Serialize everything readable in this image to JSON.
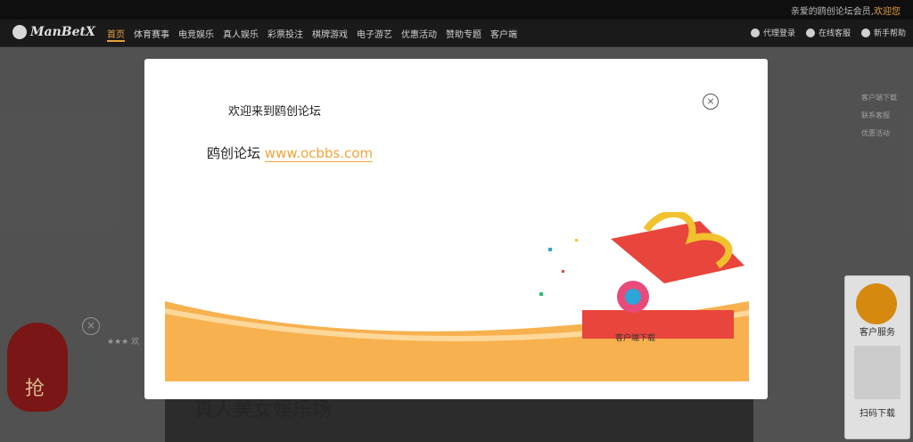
{
  "topbar": {
    "welcome_text": "亲爱的鸥创论坛会员,",
    "welcome_highlight": "欢迎您"
  },
  "logo": {
    "text": "ManBetX"
  },
  "nav": {
    "items": [
      "首页",
      "体育赛事",
      "电竞娱乐",
      "真人娱乐",
      "彩票投注",
      "棋牌游戏",
      "电子游艺",
      "优惠活动",
      "赞助专题",
      "客户端"
    ],
    "active_index": 0
  },
  "nav_right": {
    "items": [
      "代理登录",
      "在线客服",
      "新手帮助"
    ]
  },
  "page": {
    "side_links": [
      "客户端下载",
      "联系客服",
      "优惠活动"
    ],
    "stage_title": "真人美女娱乐场",
    "ticker": "★★★ 欢"
  },
  "bag": {
    "label": "抢"
  },
  "service": {
    "label": "客户服务",
    "scan_label": "扫码下载"
  },
  "modal": {
    "title": "欢迎来到鸥创论坛",
    "site_label": "鸥创论坛",
    "site_url": "www.ocbbs.com",
    "download_label": "客户端下载"
  },
  "colors": {
    "accent": "#f0a43a",
    "nav_bg": "#1a1a1a",
    "wave": "#f7b14f"
  }
}
